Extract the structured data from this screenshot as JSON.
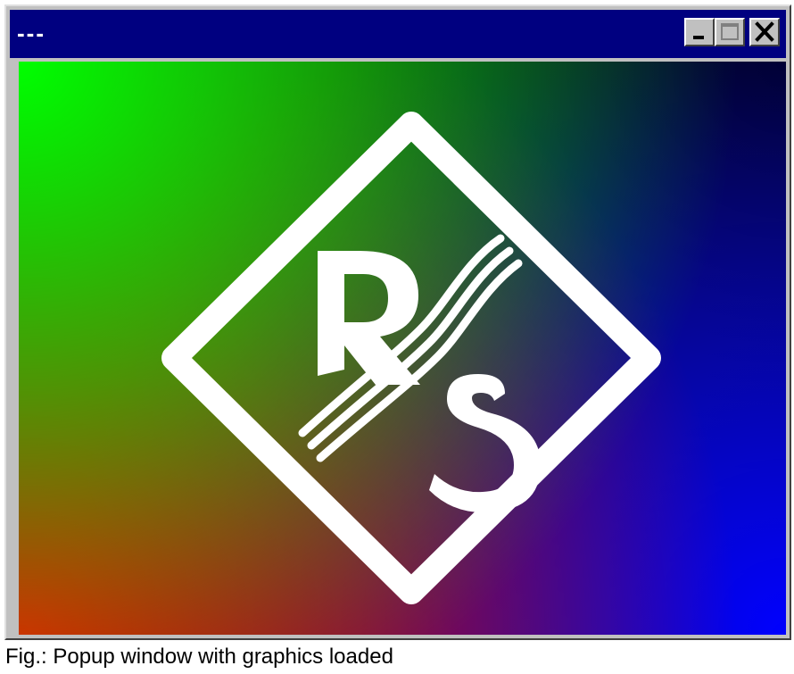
{
  "window": {
    "title": "---",
    "controls": {
      "minimize_icon": "minimize-icon",
      "maximize_icon": "maximize-icon",
      "close_icon": "close-icon"
    },
    "content": {
      "logo": "rohde-schwarz-logo",
      "logo_letters": "RS",
      "gradient_colors": {
        "top_left": "#00ff00",
        "top_right": "#000000",
        "bottom_left": "#ff0000",
        "bottom_right": "#0000ff"
      }
    }
  },
  "caption": "Fig.: Popup window with graphics loaded",
  "colors": {
    "titlebar": "#000080",
    "window_face": "#c0c0c0"
  }
}
